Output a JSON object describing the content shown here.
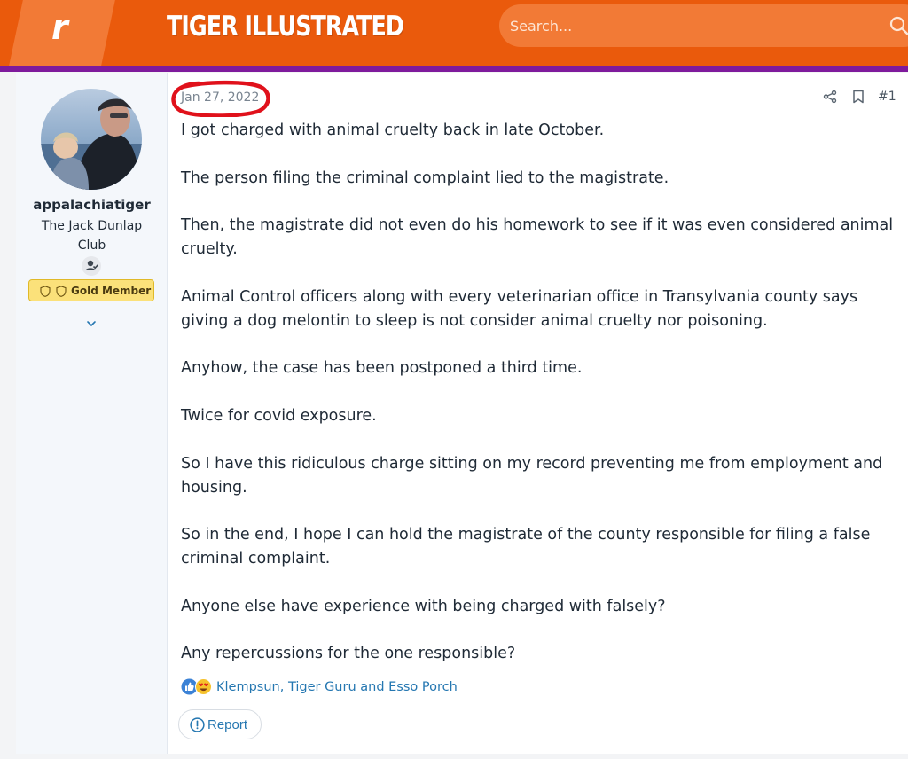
{
  "header": {
    "logo_letter": "r",
    "site_title": "TIGER ILLUSTRATED",
    "search_placeholder": "Search..."
  },
  "colors": {
    "header_orange": "#ea5a0c",
    "header_accent": "#7e1a9c",
    "link_blue": "#2577b1",
    "annotation_red": "#e0111b",
    "gold_badge": "#fbe17a"
  },
  "user": {
    "username": "appalachiatiger",
    "title": "The Jack Dunlap Club",
    "badge": "Gold Member"
  },
  "post": {
    "date": "Jan 27, 2022",
    "number": "#1",
    "paragraphs": [
      "I got charged with animal cruelty back in late October.",
      "The person filing the criminal complaint lied to the magistrate.",
      "Then, the magistrate did not even do his homework to see if it was even considered animal cruelty.",
      "Animal Control officers along with every veterinarian office in Transylvania county says giving a dog melontin to sleep is not consider animal cruelty nor poisoning.",
      "Anyhow, the case has been postponed a third time.",
      "Twice for covid exposure.",
      "So I have this ridiculous charge sitting on my record preventing me from employment and housing.",
      "So in the end, I hope I can hold the magistrate of the county responsible for filing a false criminal complaint.",
      "Anyone else have experience with being charged with falsely?",
      "Any repercussions for the one responsible?"
    ],
    "reactions_text": "Klempsun, Tiger Guru and Esso Porch",
    "report_label": "Report"
  }
}
